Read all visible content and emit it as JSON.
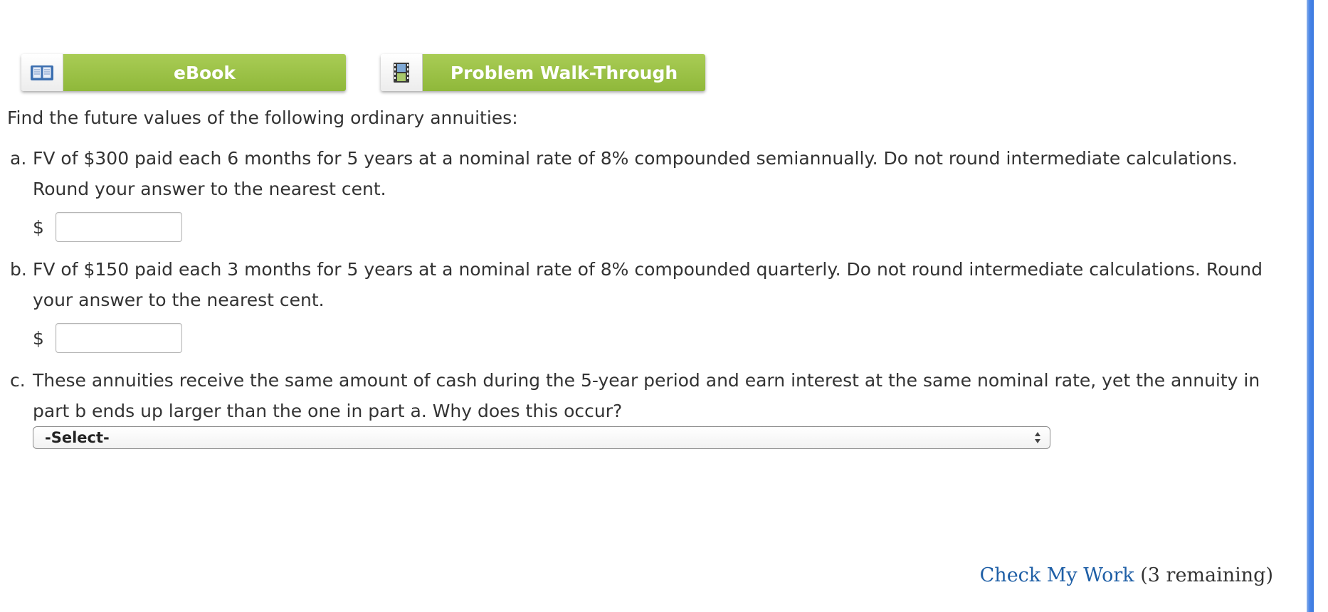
{
  "toolbar": {
    "ebook_label": "eBook",
    "walkthrough_label": "Problem Walk-Through",
    "ebook_icon": "book-icon",
    "walkthrough_icon": "film-icon",
    "button_color": "#9dc44a"
  },
  "intro": "Find the future values of the following ordinary annuities:",
  "questions": {
    "a": {
      "letter": "a.",
      "text": "FV of $300 paid each 6 months for 5 years at a nominal rate of 8% compounded semiannually. Do not round intermediate calculations. Round your answer to the nearest cent.",
      "currency": "$",
      "value": ""
    },
    "b": {
      "letter": "b.",
      "text": "FV of $150 paid each 3 months for 5 years at a nominal rate of 8% compounded quarterly. Do not round intermediate calculations. Round your answer to the nearest cent.",
      "currency": "$",
      "value": ""
    },
    "c": {
      "letter": "c.",
      "text": "These annuities receive the same amount of cash during the 5-year period and earn interest at the same nominal rate, yet the annuity in part b ends up larger than the one in part a. Why does this occur?",
      "select_value": "-Select-"
    }
  },
  "footer": {
    "check_label": "Check My Work",
    "remaining": "(3 remaining)",
    "link_color": "#1f5fa6"
  }
}
